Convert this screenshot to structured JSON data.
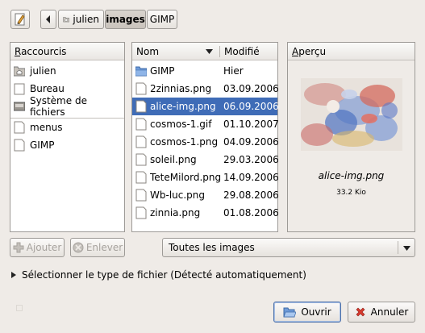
{
  "toolbar": {
    "path": [
      {
        "label": "julien",
        "active": false
      },
      {
        "label": "images",
        "active": true
      },
      {
        "label": "GIMP",
        "active": false
      }
    ]
  },
  "sidebar": {
    "header": "Raccourcis",
    "places": [
      {
        "label": "julien",
        "icon": "home-folder-icon"
      },
      {
        "label": "Bureau",
        "icon": "desktop-icon"
      },
      {
        "label": "Système de fichiers",
        "icon": "drive-icon"
      }
    ],
    "bookmarks": [
      {
        "label": "menus",
        "icon": "file-icon"
      },
      {
        "label": "GIMP",
        "icon": "file-icon"
      }
    ],
    "add_label": "Ajouter",
    "remove_label": "Enlever"
  },
  "files": {
    "col_name": "Nom",
    "col_modified": "Modifié",
    "rows": [
      {
        "name": "GIMP",
        "date": "Hier",
        "type": "folder",
        "selected": false
      },
      {
        "name": "2zinnias.png",
        "date": "03.09.2006",
        "type": "file",
        "selected": false
      },
      {
        "name": "alice-img.png",
        "date": "06.09.2006",
        "type": "file",
        "selected": true
      },
      {
        "name": "cosmos-1.gif",
        "date": "01.10.2007",
        "type": "file",
        "selected": false
      },
      {
        "name": "cosmos-1.png",
        "date": "04.09.2006",
        "type": "file",
        "selected": false
      },
      {
        "name": "soleil.png",
        "date": "29.03.2006",
        "type": "file",
        "selected": false
      },
      {
        "name": "TeteMilord.png",
        "date": "14.09.2006",
        "type": "file",
        "selected": false
      },
      {
        "name": "Wb-luc.png",
        "date": "29.08.2006",
        "type": "file",
        "selected": false
      },
      {
        "name": "zinnia.png",
        "date": "01.08.2006",
        "type": "file",
        "selected": false
      }
    ]
  },
  "preview": {
    "header": "Aperçu",
    "filename": "alice-img.png",
    "size": "33.2 Kio"
  },
  "filter": {
    "selected": "Toutes les images"
  },
  "expander": {
    "label": "Sélectionner le type de fichier (Détecté automatiquement)"
  },
  "actions": {
    "open_label": "Ouvrir",
    "cancel_label": "Annuler"
  },
  "colors": {
    "selection": "#3f6cb7",
    "window_bg": "#efebe7"
  }
}
